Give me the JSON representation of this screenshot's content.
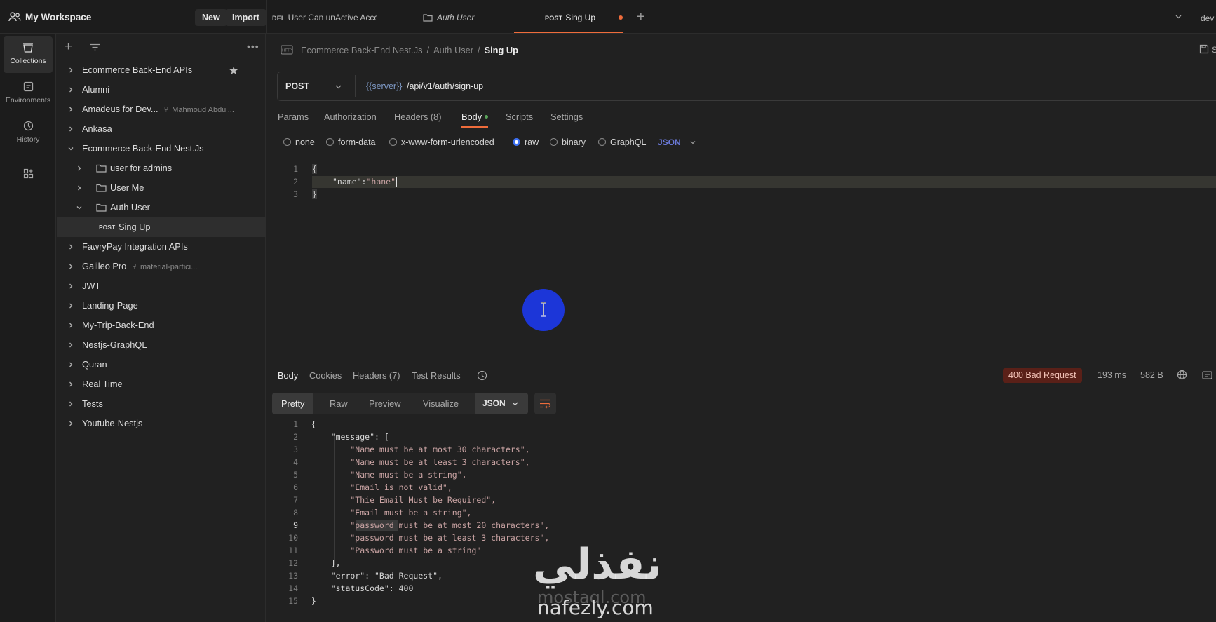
{
  "workspace": {
    "title": "My Workspace",
    "new_label": "New",
    "import_label": "Import"
  },
  "tabs": [
    {
      "method": "DEL",
      "label": "User Can unActive Acco",
      "method_color": "#b5b5b5"
    },
    {
      "method": "",
      "label": "Auth User"
    },
    {
      "method": "POST",
      "label": "Sing Up",
      "active": true
    }
  ],
  "env_label": "dev",
  "rail": {
    "collections": "Collections",
    "environments": "Environments",
    "history": "History"
  },
  "sidebar": {
    "items": [
      {
        "label": "Ecommerce Back-End APIs",
        "level": 0,
        "starred": true
      },
      {
        "label": "Alumni",
        "level": 0
      },
      {
        "label": "Amadeus for Dev...",
        "level": 0,
        "fork": "Mahmoud Abdul..."
      },
      {
        "label": "Ankasa",
        "level": 0
      },
      {
        "label": "Ecommerce Back-End Nest.Js",
        "level": 0,
        "expanded": true
      },
      {
        "label": "user for admins",
        "level": 1,
        "folder": true
      },
      {
        "label": "User Me",
        "level": 1,
        "folder": true
      },
      {
        "label": "Auth User",
        "level": 1,
        "folder": true,
        "expanded": true
      },
      {
        "label": "Sing Up",
        "level": 2,
        "method": "POST",
        "active": true
      },
      {
        "label": "FawryPay Integration APIs",
        "level": 0
      },
      {
        "label": "Galileo Pro",
        "level": 0,
        "fork": "material-partici..."
      },
      {
        "label": "JWT",
        "level": 0
      },
      {
        "label": "Landing-Page",
        "level": 0
      },
      {
        "label": "My-Trip-Back-End",
        "level": 0
      },
      {
        "label": "Nestjs-GraphQL",
        "level": 0
      },
      {
        "label": "Quran",
        "level": 0
      },
      {
        "label": "Real Time",
        "level": 0
      },
      {
        "label": "Tests",
        "level": 0
      },
      {
        "label": "Youtube-Nestjs",
        "level": 0
      }
    ]
  },
  "breadcrumb": {
    "collection": "Ecommerce Back-End Nest.Js",
    "folder": "Auth User",
    "current": "Sing Up",
    "sep": "/"
  },
  "save_label": "S",
  "request": {
    "method": "POST",
    "url_var": "{{server}}",
    "url_path": "/api/v1/auth/sign-up",
    "tabs": {
      "params": "Params",
      "authorization": "Authorization",
      "headers": "Headers (8)",
      "body": "Body",
      "scripts": "Scripts",
      "settings": "Settings"
    },
    "body_modes": {
      "none": "none",
      "form": "form-data",
      "urlencoded": "x-www-form-urlencoded",
      "raw": "raw",
      "binary": "binary",
      "graphql": "GraphQL",
      "json": "JSON"
    },
    "body_lines": [
      "1",
      "2",
      "3"
    ],
    "body_code": {
      "open": "{",
      "key": "\"name\"",
      "colon": ":",
      "value": "\"hane\"",
      "close": "}"
    }
  },
  "response": {
    "tabs": {
      "body": "Body",
      "cookies": "Cookies",
      "headers": "Headers (7)",
      "tests": "Test Results"
    },
    "status": "400 Bad Request",
    "time": "193 ms",
    "size": "582 B",
    "formats": {
      "pretty": "Pretty",
      "raw": "Raw",
      "preview": "Preview",
      "visualize": "Visualize",
      "json": "JSON"
    },
    "lines": [
      {
        "n": "1",
        "text": "{"
      },
      {
        "n": "2",
        "text": "    \"message\": ["
      },
      {
        "n": "3",
        "text": "        \"Name must be at most 30 characters\","
      },
      {
        "n": "4",
        "text": "        \"Name must be at least 3 characters\","
      },
      {
        "n": "5",
        "text": "        \"Name must be a string\","
      },
      {
        "n": "6",
        "text": "        \"Email is not valid\","
      },
      {
        "n": "7",
        "text": "        \"Thie Email Must be Required\","
      },
      {
        "n": "8",
        "text": "        \"Email must be a string\","
      },
      {
        "n": "9",
        "text": "        \"password must be at most 20 characters\","
      },
      {
        "n": "10",
        "text": "        \"password must be at least 3 characters\","
      },
      {
        "n": "11",
        "text": "        \"Password must be a string\""
      },
      {
        "n": "12",
        "text": "    ],"
      },
      {
        "n": "13",
        "text": "    \"error\": \"Bad Request\","
      },
      {
        "n": "14",
        "text": "    \"statusCode\": 400"
      },
      {
        "n": "15",
        "text": "}"
      }
    ]
  },
  "watermark": {
    "arabic": "نفذلي",
    "mostaql": "mostaql.com",
    "nafezly": "nafezly.com"
  }
}
